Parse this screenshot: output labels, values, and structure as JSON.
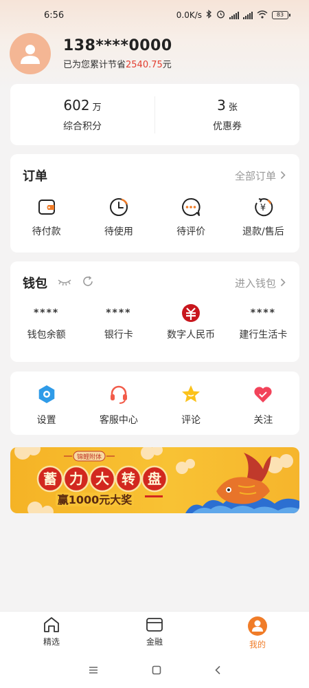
{
  "status_bar": {
    "time": "6:56",
    "network_speed": "0.0K/s",
    "battery": "83"
  },
  "profile": {
    "phone": "138****0000",
    "saving_prefix": "已为您累计节省",
    "saving_amount": "2540.75",
    "saving_suffix": "元"
  },
  "stats": [
    {
      "value": "602",
      "unit": "万",
      "label": "综合积分"
    },
    {
      "value": "3",
      "unit": "张",
      "label": "优惠券"
    }
  ],
  "orders": {
    "title": "订单",
    "link": "全部订单",
    "items": [
      {
        "label": "待付款",
        "icon": "wallet-icon"
      },
      {
        "label": "待使用",
        "icon": "clock-icon"
      },
      {
        "label": "待评价",
        "icon": "chat-icon"
      },
      {
        "label": "退款/售后",
        "icon": "refund-icon"
      }
    ]
  },
  "wallet": {
    "title": "钱包",
    "link": "进入钱包",
    "items": [
      {
        "value": "****",
        "label": "钱包余额"
      },
      {
        "value": "****",
        "label": "银行卡"
      },
      {
        "value": "",
        "label": "数字人民币",
        "icon": "digital-rmb-icon"
      },
      {
        "value": "****",
        "label": "建行生活卡"
      }
    ]
  },
  "tools": [
    {
      "label": "设置",
      "icon": "settings-icon"
    },
    {
      "label": "客服中心",
      "icon": "headset-icon"
    },
    {
      "label": "评论",
      "icon": "star-icon"
    },
    {
      "label": "关注",
      "icon": "heart-icon"
    }
  ],
  "banner": {
    "tag": "锦鲤附体",
    "title_chars": [
      "蓄",
      "力",
      "大",
      "转",
      "盘"
    ],
    "subtitle": "赢1000元大奖"
  },
  "tabbar": [
    {
      "label": "精选",
      "icon": "home-icon",
      "active": false
    },
    {
      "label": "金融",
      "icon": "card-icon",
      "active": false
    },
    {
      "label": "我的",
      "icon": "user-icon",
      "active": true
    }
  ],
  "colors": {
    "accent": "#f07c28",
    "saving_amount": "#e23d2f",
    "avatar_bg": "#f4b694",
    "banner_bg": "#f8c234"
  }
}
